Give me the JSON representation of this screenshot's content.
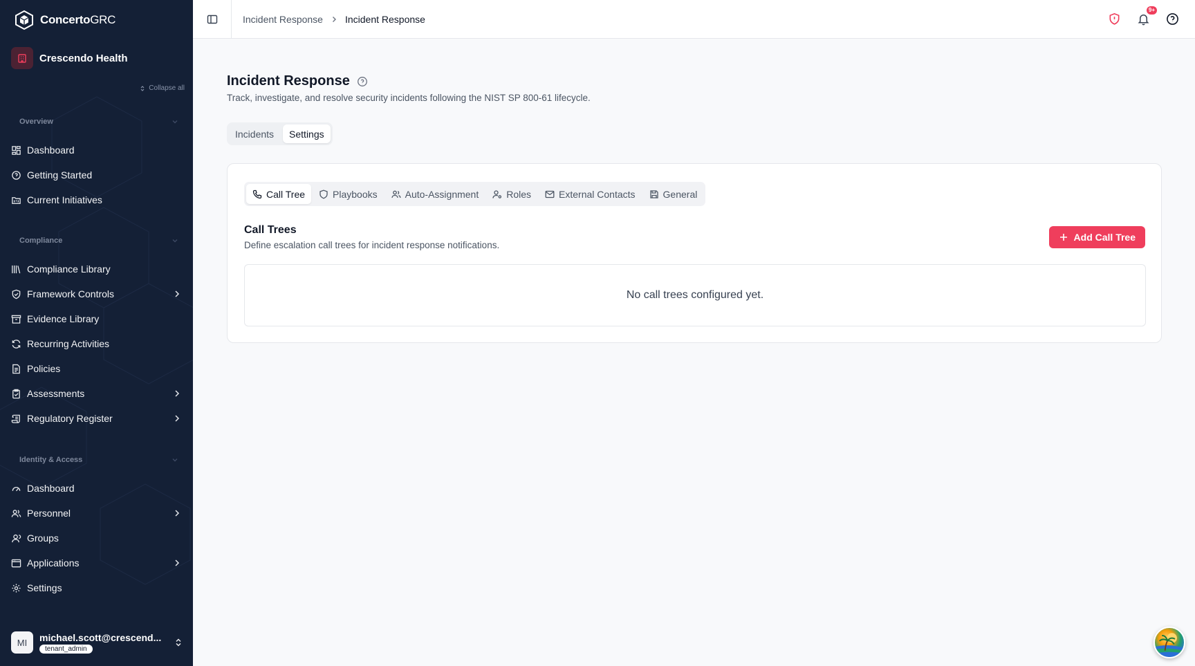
{
  "brand": {
    "name_bold": "Concerto",
    "name_light": "GRC"
  },
  "org": {
    "name": "Crescendo Health"
  },
  "sidebar": {
    "collapse_all": "Collapse all",
    "sections": [
      {
        "label": "Overview"
      },
      {
        "label": "Compliance"
      },
      {
        "label": "Identity & Access"
      }
    ],
    "overview_items": [
      {
        "label": "Dashboard",
        "icon": "grid-icon"
      },
      {
        "label": "Getting Started",
        "icon": "help-circle-icon"
      },
      {
        "label": "Current Initiatives",
        "icon": "folder-kanban-icon"
      }
    ],
    "compliance_items": [
      {
        "label": "Compliance Library",
        "icon": "library-icon"
      },
      {
        "label": "Framework Controls",
        "icon": "shield-check-icon",
        "has_children": true
      },
      {
        "label": "Evidence Library",
        "icon": "archive-icon"
      },
      {
        "label": "Recurring Activities",
        "icon": "refresh-icon"
      },
      {
        "label": "Policies",
        "icon": "file-text-icon"
      },
      {
        "label": "Assessments",
        "icon": "clipboard-check-icon",
        "has_children": true
      },
      {
        "label": "Regulatory Register",
        "icon": "scroll-icon",
        "has_children": true
      }
    ],
    "identity_items": [
      {
        "label": "Dashboard",
        "icon": "gauge-icon"
      },
      {
        "label": "Personnel",
        "icon": "users-icon",
        "has_children": true
      },
      {
        "label": "Groups",
        "icon": "user-group-icon"
      },
      {
        "label": "Applications",
        "icon": "app-window-icon",
        "has_children": true
      },
      {
        "label": "Settings",
        "icon": "gear-icon"
      }
    ],
    "user": {
      "initials": "MI",
      "email": "michael.scott@crescend...",
      "role": "tenant_admin"
    }
  },
  "topbar": {
    "breadcrumb": [
      "Incident Response",
      "Incident Response"
    ],
    "notification_badge": "9+"
  },
  "page": {
    "title": "Incident Response",
    "subtitle": "Track, investigate, and resolve security incidents following the NIST SP 800-61 lifecycle.",
    "tabs": [
      {
        "label": "Incidents",
        "active": false
      },
      {
        "label": "Settings",
        "active": true
      }
    ],
    "settings_tabs": [
      {
        "label": "Call Tree",
        "icon": "phone-icon",
        "active": true
      },
      {
        "label": "Playbooks",
        "icon": "shield-icon",
        "active": false
      },
      {
        "label": "Auto-Assignment",
        "icon": "users-icon",
        "active": false
      },
      {
        "label": "Roles",
        "icon": "user-cog-icon",
        "active": false
      },
      {
        "label": "External Contacts",
        "icon": "mail-icon",
        "active": false
      },
      {
        "label": "General",
        "icon": "save-icon",
        "active": false
      }
    ],
    "section_title": "Call Trees",
    "section_desc": "Define escalation call trees for incident response notifications.",
    "add_button": "Add Call Tree",
    "empty_message": "No call trees configured yet."
  },
  "colors": {
    "sidebar_bg": "#142036",
    "accent": "#ef3e5c"
  }
}
